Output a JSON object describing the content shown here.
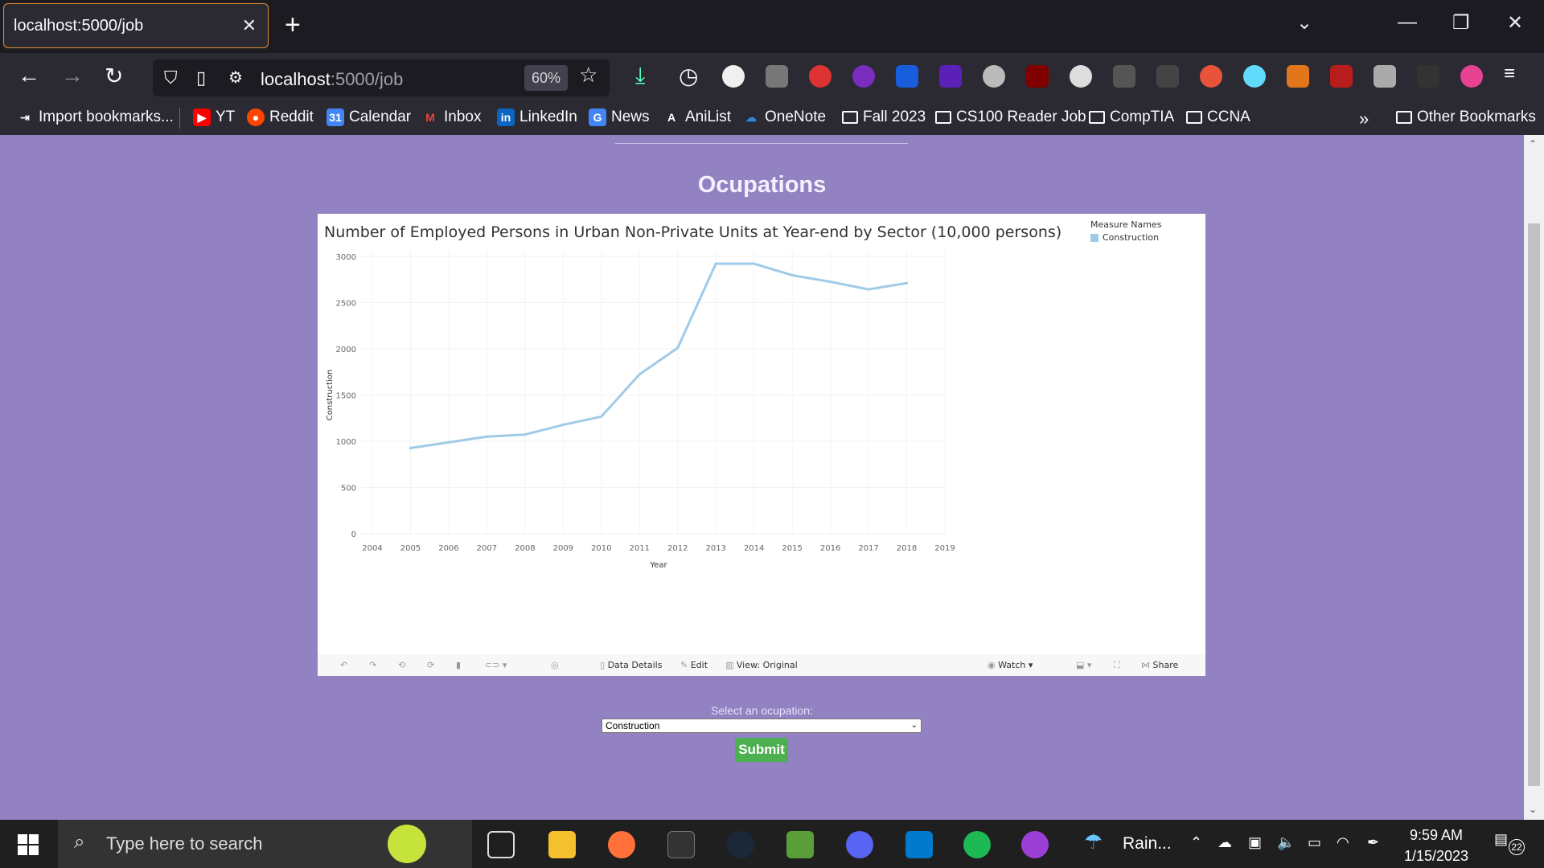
{
  "browser": {
    "tab_title": "localhost:5000/job",
    "url_host": "localhost",
    "url_path": ":5000/job",
    "zoom": "60%",
    "bookmarks": [
      {
        "label": "Import bookmarks...",
        "icon": "import-icon"
      },
      {
        "label": "YT",
        "icon": "youtube-icon"
      },
      {
        "label": "Reddit",
        "icon": "reddit-icon"
      },
      {
        "label": "Calendar",
        "icon": "calendar-icon"
      },
      {
        "label": "Inbox",
        "icon": "gmail-icon"
      },
      {
        "label": "LinkedIn",
        "icon": "linkedin-icon"
      },
      {
        "label": "News",
        "icon": "news-icon"
      },
      {
        "label": "AniList",
        "icon": "anilist-icon"
      },
      {
        "label": "OneNote",
        "icon": "onenote-icon"
      },
      {
        "label": "Fall 2023",
        "icon": "folder-icon"
      },
      {
        "label": "CS100 Reader Job",
        "icon": "folder-icon"
      },
      {
        "label": "CompTIA",
        "icon": "folder-icon"
      },
      {
        "label": "CCNA",
        "icon": "folder-icon"
      },
      {
        "label": "Other Bookmarks",
        "icon": "folder-icon"
      }
    ]
  },
  "page": {
    "title": "Ocupations",
    "select_label": "Select an ocupation:",
    "select_value": "Construction",
    "submit_label": "Submit"
  },
  "viz": {
    "legend_title": "Measure Names",
    "legend_item": "Construction",
    "toolbar": {
      "data_details": "Data Details",
      "edit": "Edit",
      "view": "View: Original",
      "watch": "Watch",
      "share": "Share"
    }
  },
  "chart_data": {
    "type": "line",
    "title": "Number of Employed Persons in Urban Non-Private Units at Year-end by Sector (10,000 persons)",
    "xlabel": "Year",
    "ylabel": "Construction",
    "x_ticks": [
      2004,
      2005,
      2006,
      2007,
      2008,
      2009,
      2010,
      2011,
      2012,
      2013,
      2014,
      2015,
      2016,
      2017,
      2018,
      2019
    ],
    "y_ticks": [
      0,
      500,
      1000,
      1500,
      2000,
      2500,
      3000
    ],
    "xlim": [
      2004,
      2019
    ],
    "ylim": [
      0,
      3000
    ],
    "grid": true,
    "legend": "top-right",
    "series": [
      {
        "name": "Construction",
        "color": "#a0cbe8",
        "x": [
          2005,
          2006,
          2007,
          2008,
          2009,
          2010,
          2011,
          2012,
          2013,
          2014,
          2015,
          2016,
          2017,
          2018
        ],
        "values": [
          926,
          988,
          1050,
          1072,
          1178,
          1267,
          1724,
          2010,
          2922,
          2921,
          2796,
          2725,
          2643,
          2711
        ]
      }
    ]
  },
  "taskbar": {
    "search_placeholder": "Type here to search",
    "weather": "Rain...",
    "time": "9:59 AM",
    "date": "1/15/2023",
    "notifications": "22"
  }
}
